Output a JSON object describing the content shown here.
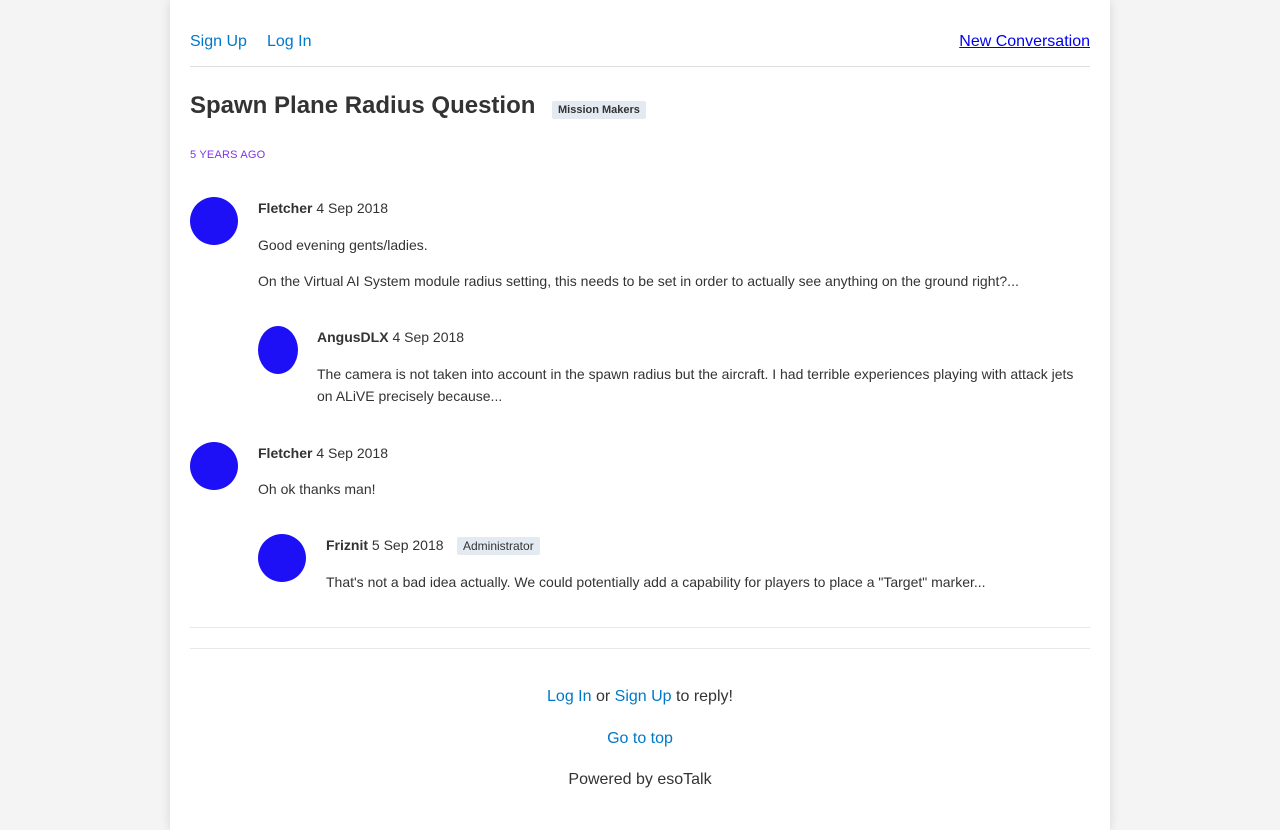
{
  "nav": {
    "signup": "Sign Up",
    "login": "Log In",
    "new_conversation": "New Conversation"
  },
  "conversation": {
    "title": "Spawn Plane Radius Question",
    "channel": "Mission Makers",
    "time_ago": "5 YEARS AGO"
  },
  "posts": [
    {
      "author": "Fletcher",
      "date": "4 Sep 2018",
      "paragraphs": [
        "Good evening gents/ladies.",
        "On the Virtual AI System module radius setting, this needs to be set in order to actually see anything on the ground right?..."
      ]
    },
    {
      "author": "AngusDLX",
      "date": "4 Sep 2018",
      "paragraphs": [
        "The camera is not taken into account in the spawn radius but the aircraft. I had terrible experiences playing with attack jets on ALiVE precisely because..."
      ]
    },
    {
      "author": "Fletcher",
      "date": "4 Sep 2018",
      "paragraphs": [
        "Oh ok thanks man!"
      ]
    },
    {
      "author": "Friznit",
      "date": "5 Sep 2018",
      "role": "Administrator",
      "paragraphs": [
        "That's not a bad idea actually. We could potentially add a capability for players to place a \"Target\" marker..."
      ]
    }
  ],
  "footer": {
    "login": "Log In",
    "or": "or",
    "signup": "Sign Up",
    "to_reply": "to reply!",
    "go_to_top": "Go to top",
    "powered_by": "Powered by esoTalk"
  },
  "colors": {
    "page_background": "#f4f4f4",
    "link": "#0078c8",
    "avatar": "#1d10f7",
    "time_ago": "#7f34e8",
    "badge_background": "#e4eaf1"
  }
}
